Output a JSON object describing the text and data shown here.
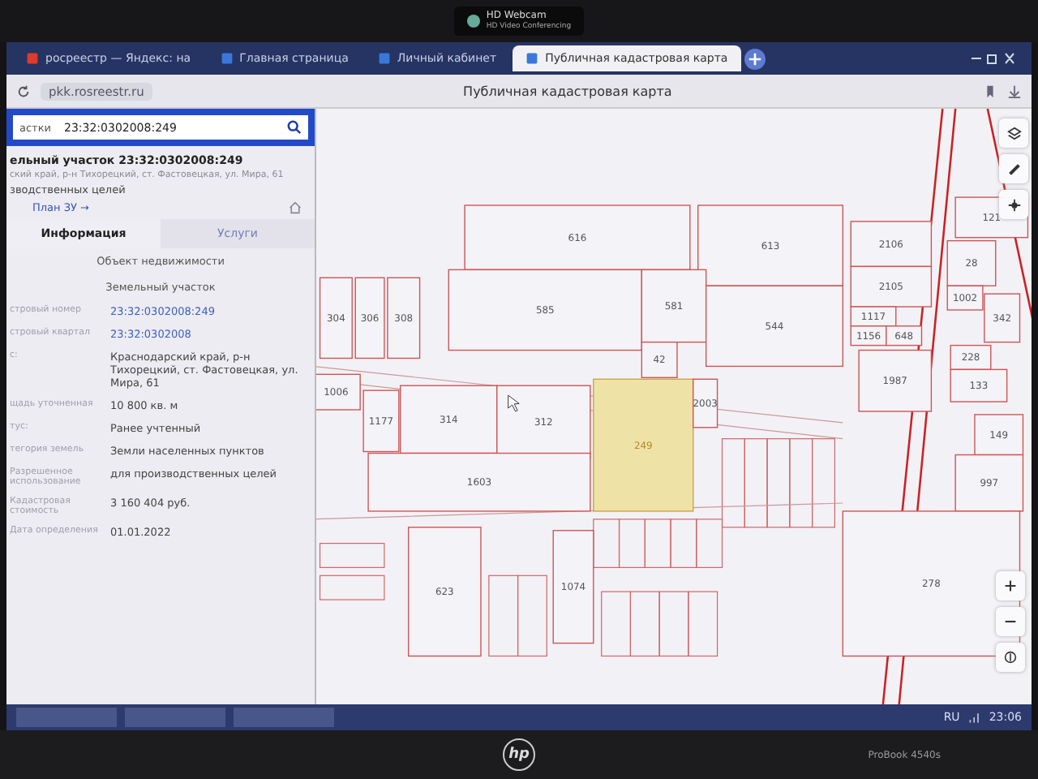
{
  "bezel": {
    "webcam_label": "HD Webcam",
    "webcam_sublabel": "HD Video Conferencing",
    "brand": "hp",
    "model": "ProBook 4540s"
  },
  "browser": {
    "tabs": [
      {
        "label": "росреестр — Яндекс: на",
        "selected": false
      },
      {
        "label": "Главная страница",
        "selected": false
      },
      {
        "label": "Личный кабинет",
        "selected": false
      },
      {
        "label": "Публичная кадастровая карта",
        "selected": true
      }
    ],
    "url": "pkk.rosreestr.ru",
    "page_title": "Публичная кадастровая карта"
  },
  "search": {
    "category": "астки",
    "value": "23:32:0302008:249"
  },
  "object": {
    "title": "ельный участок 23:32:0302008:249",
    "address": "ский край, р-н Тихорецкий, ст. Фастовецкая, ул. Мира, 61",
    "purpose": "зводственных целей",
    "plan_link": "План ЗУ →"
  },
  "panel_tabs": [
    {
      "label": "Информация",
      "selected": true
    },
    {
      "label": "Услуги",
      "selected": false
    }
  ],
  "info_header": "Объект недвижимости",
  "info_type": "Земельный участок",
  "fields": [
    {
      "label": "стровый номер",
      "value": "23:32:0302008:249",
      "kind": "link"
    },
    {
      "label": "стровый квартал",
      "value": "23:32:0302008",
      "kind": "link"
    },
    {
      "label": "с:",
      "value": "Краснодарский край, р-н Тихорецкий, ст. Фастовецкая, ул. Мира, 61",
      "kind": "text"
    },
    {
      "label": "щадь уточненная",
      "value": "10 800 кв. м",
      "kind": "text"
    },
    {
      "label": "тус:",
      "value": "Ранее учтенный",
      "kind": "text"
    },
    {
      "label": "тегория земель",
      "value": "Земли населенных пунктов",
      "kind": "text"
    },
    {
      "label": "Разрешенное использование",
      "value": "для производственных целей",
      "kind": "text"
    },
    {
      "label": "Кадастровая стоимость",
      "value": "3 160 404 руб.",
      "kind": "text"
    },
    {
      "label": "Дата определения",
      "value": "01.01.2022",
      "kind": "text"
    }
  ],
  "map": {
    "parcels": [
      {
        "label": "616",
        "selected": false
      },
      {
        "label": "613",
        "selected": false
      },
      {
        "label": "585",
        "selected": false
      },
      {
        "label": "581",
        "selected": false
      },
      {
        "label": "544",
        "selected": false
      },
      {
        "label": "42",
        "selected": false
      },
      {
        "label": "2106",
        "selected": false
      },
      {
        "label": "2105",
        "selected": false
      },
      {
        "label": "1117",
        "selected": false
      },
      {
        "label": "1156",
        "selected": false
      },
      {
        "label": "648",
        "selected": false
      },
      {
        "label": "1987",
        "selected": false
      },
      {
        "label": "121",
        "selected": false
      },
      {
        "label": "28",
        "selected": false
      },
      {
        "label": "1002",
        "selected": false
      },
      {
        "label": "342",
        "selected": false
      },
      {
        "label": "228",
        "selected": false
      },
      {
        "label": "133",
        "selected": false
      },
      {
        "label": "149",
        "selected": false
      },
      {
        "label": "997",
        "selected": false
      },
      {
        "label": "304",
        "selected": false
      },
      {
        "label": "306",
        "selected": false
      },
      {
        "label": "308",
        "selected": false
      },
      {
        "label": "1006",
        "selected": false
      },
      {
        "label": "314",
        "selected": false
      },
      {
        "label": "312",
        "selected": false
      },
      {
        "label": "249",
        "selected": true
      },
      {
        "label": "1603",
        "selected": false
      },
      {
        "label": "1177",
        "selected": false
      },
      {
        "label": "2003",
        "selected": false
      },
      {
        "label": "623",
        "selected": false
      },
      {
        "label": "1074",
        "selected": false
      },
      {
        "label": "278",
        "selected": false
      }
    ]
  },
  "taskbar": {
    "language": "RU",
    "time": "23:06"
  }
}
